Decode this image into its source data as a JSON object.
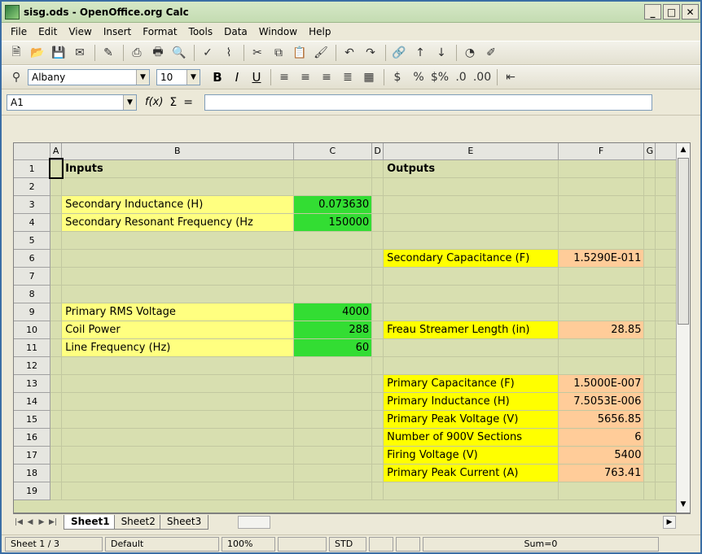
{
  "window": {
    "title": "sisg.ods - OpenOffice.org Calc"
  },
  "menu": [
    "File",
    "Edit",
    "View",
    "Insert",
    "Format",
    "Tools",
    "Data",
    "Window",
    "Help"
  ],
  "format_toolbar": {
    "font_name": "Albany",
    "font_size": "10"
  },
  "formula_bar": {
    "cell_ref": "A1",
    "input_value": ""
  },
  "columns": [
    "",
    "A",
    "B",
    "C",
    "D",
    "E",
    "F",
    "G"
  ],
  "rows": [
    {
      "n": "1",
      "b": "Inputs",
      "c": "",
      "e": "Outputs",
      "f": ""
    },
    {
      "n": "2",
      "b": "",
      "c": "",
      "e": "",
      "f": ""
    },
    {
      "n": "3",
      "b": "Secondary Inductance (H)",
      "c": "0.073630",
      "e": "",
      "f": ""
    },
    {
      "n": "4",
      "b": "Secondary Resonant Frequency (Hz",
      "c": "150000",
      "e": "",
      "f": ""
    },
    {
      "n": "5",
      "b": "",
      "c": "",
      "e": "",
      "f": ""
    },
    {
      "n": "6",
      "b": "",
      "c": "",
      "e": "Secondary Capacitance (F)",
      "f": "1.5290E-011"
    },
    {
      "n": "7",
      "b": "",
      "c": "",
      "e": "",
      "f": ""
    },
    {
      "n": "8",
      "b": "",
      "c": "",
      "e": "",
      "f": ""
    },
    {
      "n": "9",
      "b": "Primary RMS Voltage",
      "c": "4000",
      "e": "",
      "f": ""
    },
    {
      "n": "10",
      "b": "Coil Power",
      "c": "288",
      "e": "Freau Streamer Length (in)",
      "f": "28.85"
    },
    {
      "n": "11",
      "b": "Line Frequency (Hz)",
      "c": "60",
      "e": "",
      "f": ""
    },
    {
      "n": "12",
      "b": "",
      "c": "",
      "e": "",
      "f": ""
    },
    {
      "n": "13",
      "b": "",
      "c": "",
      "e": "Primary Capacitance (F)",
      "f": "1.5000E-007"
    },
    {
      "n": "14",
      "b": "",
      "c": "",
      "e": "Primary Inductance (H)",
      "f": "7.5053E-006"
    },
    {
      "n": "15",
      "b": "",
      "c": "",
      "e": "Primary Peak Voltage (V)",
      "f": "5656.85"
    },
    {
      "n": "16",
      "b": "",
      "c": "",
      "e": "Number of 900V Sections",
      "f": "6"
    },
    {
      "n": "17",
      "b": "",
      "c": "",
      "e": "Firing Voltage (V)",
      "f": "5400"
    },
    {
      "n": "18",
      "b": "",
      "c": "",
      "e": "Primary Peak Current (A)",
      "f": "763.41"
    },
    {
      "n": "19",
      "b": "",
      "c": "",
      "e": "",
      "f": ""
    }
  ],
  "sheet_tabs": [
    "Sheet1",
    "Sheet2",
    "Sheet3"
  ],
  "status": {
    "sheet": "Sheet 1 / 3",
    "style": "Default",
    "zoom": "100%",
    "mode": "STD",
    "sum": "Sum=0"
  },
  "colors": {
    "input_cell": "#33dd33",
    "label_cell": "#ffff80",
    "output_label": "#ffff00",
    "output_value": "#ffcc99",
    "grid_bg": "#d8dfb0"
  }
}
